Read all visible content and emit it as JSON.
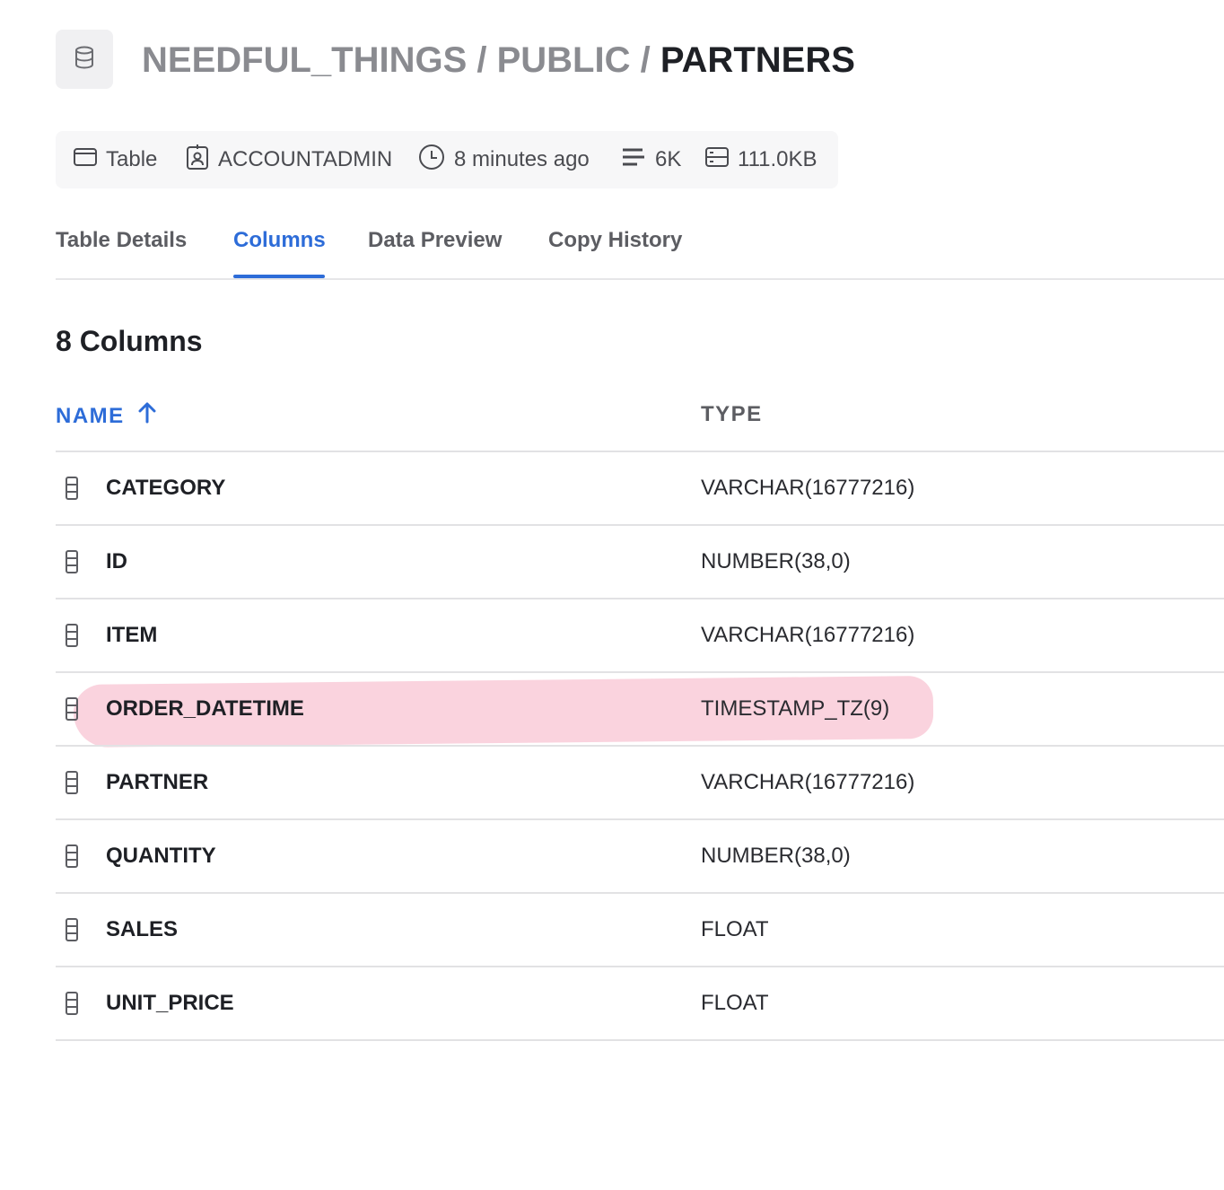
{
  "header": {
    "icon": "database-icon",
    "crumbs": {
      "database": "NEEDFUL_THINGS",
      "sep1": " / ",
      "schema": "PUBLIC",
      "sep2": " / ",
      "table": "PARTNERS"
    }
  },
  "meta": {
    "type": {
      "icon": "table-icon",
      "label": "Table"
    },
    "owner": {
      "icon": "user-badge-icon",
      "label": "ACCOUNTADMIN"
    },
    "updated": {
      "icon": "clock-icon",
      "label": "8 minutes ago"
    },
    "rows": {
      "icon": "rows-icon",
      "label": "6K"
    },
    "size": {
      "icon": "storage-icon",
      "label": "111.0KB"
    }
  },
  "tabs": [
    {
      "label": "Table Details",
      "active": false
    },
    {
      "label": "Columns",
      "active": true
    },
    {
      "label": "Data Preview",
      "active": false
    },
    {
      "label": "Copy History",
      "active": false
    }
  ],
  "section_title": "8 Columns",
  "columns_header": {
    "name": "NAME",
    "type": "TYPE",
    "sort_icon": "arrow-up-icon",
    "sort": "ascending"
  },
  "columns": [
    {
      "name": "CATEGORY",
      "type": "VARCHAR(16777216)",
      "icon": "column-icon"
    },
    {
      "name": "ID",
      "type": "NUMBER(38,0)",
      "icon": "column-icon"
    },
    {
      "name": "ITEM",
      "type": "VARCHAR(16777216)",
      "icon": "column-icon"
    },
    {
      "name": "ORDER_DATETIME",
      "type": "TIMESTAMP_TZ(9)",
      "icon": "column-icon",
      "highlighted": true
    },
    {
      "name": "PARTNER",
      "type": "VARCHAR(16777216)",
      "icon": "column-icon"
    },
    {
      "name": "QUANTITY",
      "type": "NUMBER(38,0)",
      "icon": "column-icon"
    },
    {
      "name": "SALES",
      "type": "FLOAT",
      "icon": "column-icon"
    },
    {
      "name": "UNIT_PRICE",
      "type": "FLOAT",
      "icon": "column-icon"
    }
  ],
  "colors": {
    "accent": "#2d6cd8",
    "highlight": "#f7c9d6",
    "muted": "#8a8b90"
  }
}
